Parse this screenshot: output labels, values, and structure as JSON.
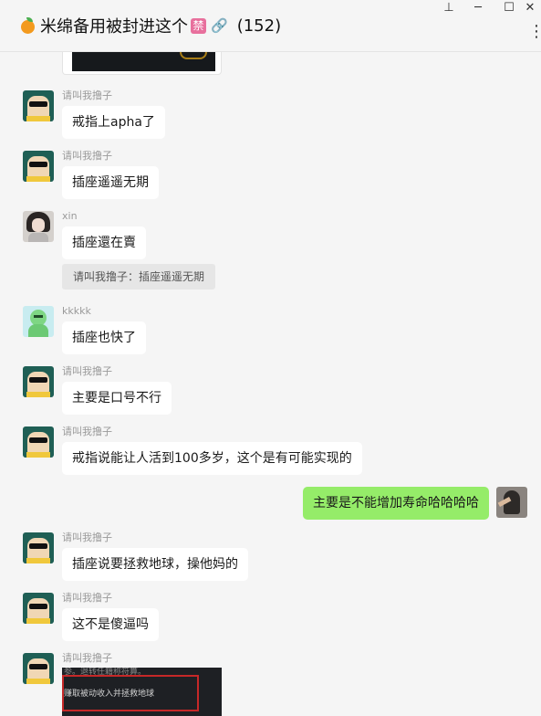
{
  "window": {
    "title": "米绵备用被封进这个",
    "ban_badge": "禁",
    "link_icon": "🔗",
    "member_count": "(152)",
    "pin_icon": "⊥",
    "minimize_icon": "─",
    "maximize_icon": "☐",
    "close_icon": "✕",
    "more_icon": "⋮"
  },
  "messages": [
    {
      "sender": "请叫我撸子",
      "text": "戒指上apha了"
    },
    {
      "sender": "请叫我撸子",
      "text": "插座遥遥无期"
    },
    {
      "sender": "xin",
      "text": "插座還在賣",
      "quote": "请叫我撸子：插座遥遥无期"
    },
    {
      "sender": "kkkkk",
      "text": "插座也快了"
    },
    {
      "sender": "请叫我撸子",
      "text": "主要是口号不行"
    },
    {
      "sender": "请叫我撸子",
      "text": "戒指说能让人活到100多岁，这个是有可能实现的"
    },
    {
      "sender": "",
      "text": "主要是不能增加寿命哈哈哈哈"
    },
    {
      "sender": "请叫我撸子",
      "text": "插座说要拯救地球，操他妈的"
    },
    {
      "sender": "请叫我撸子",
      "text": "这不是傻逼吗"
    },
    {
      "sender": "请叫我撸子",
      "image_caption_top": "参。退转任籍称符算。",
      "image_caption_box": "赚取被动收入并拯救地球"
    }
  ]
}
